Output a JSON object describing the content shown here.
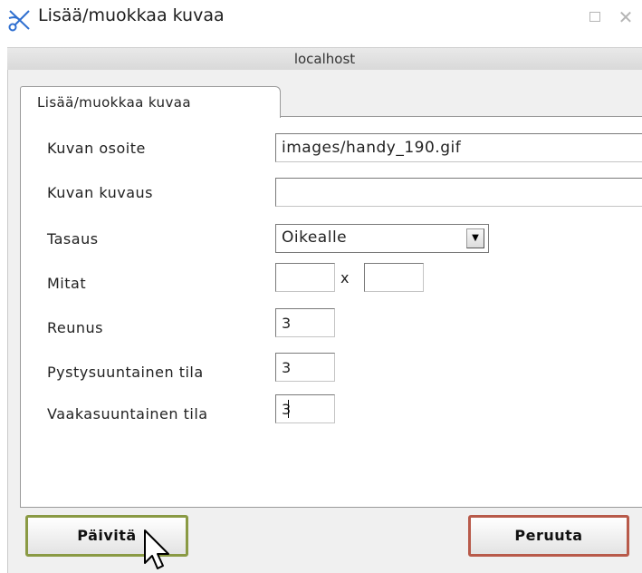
{
  "window": {
    "title": "Lisää/muokkaa kuvaa",
    "host": "localhost"
  },
  "tab": {
    "label": "Lisää/muokkaa kuvaa"
  },
  "form": {
    "url_label": "Kuvan osoite",
    "url_value": "images/handy_190.gif",
    "desc_label": "Kuvan kuvaus",
    "desc_value": "",
    "align_label": "Tasaus",
    "align_value": "Oikealle",
    "dims_label": "Mitat",
    "dims_separator": "x",
    "width_value": "",
    "height_value": "",
    "border_label": "Reunus",
    "border_value": "3",
    "vspace_label": "Pystysuuntainen tila",
    "vspace_value": "3",
    "hspace_label": "Vaakasuuntainen tila",
    "hspace_value": "3"
  },
  "buttons": {
    "update": "Päivitä",
    "cancel": "Peruuta"
  },
  "icons": {
    "app": "scissors-icon",
    "maximize": "maximize-icon",
    "close": "close-icon",
    "dropdown": "chevron-down-icon",
    "cursor": "mouse-pointer-icon"
  }
}
